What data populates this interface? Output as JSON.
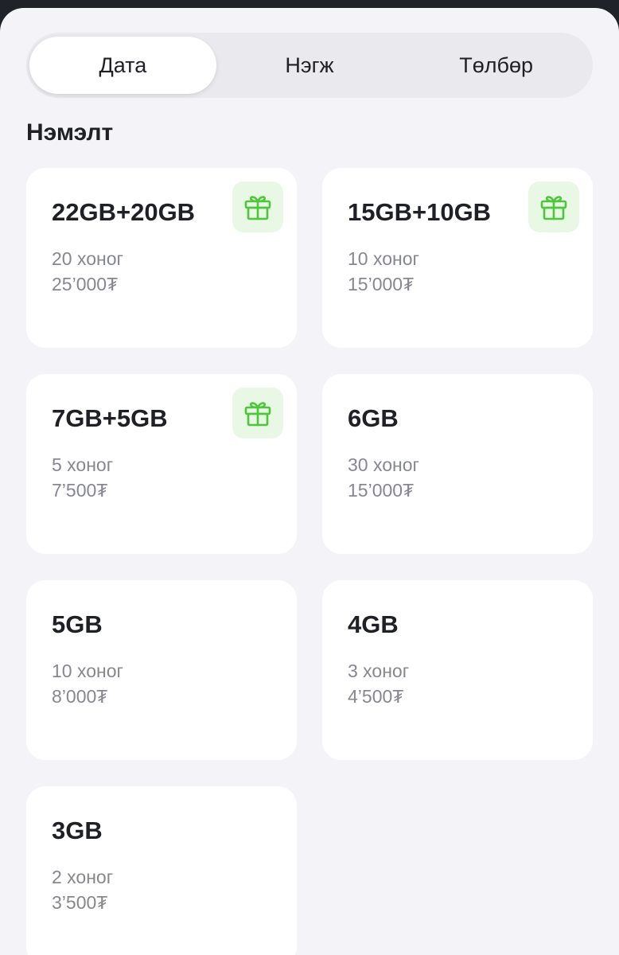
{
  "tabs": [
    {
      "label": "Дата",
      "active": true
    },
    {
      "label": "Нэгж",
      "active": false
    },
    {
      "label": "Төлбөр",
      "active": false
    }
  ],
  "section": {
    "title": "Нэмэлт"
  },
  "colors": {
    "accent_green": "#4cc73a",
    "gift_bg": "#e8f8e4"
  },
  "packages": [
    {
      "title": "22GB+20GB",
      "days": "20 хоног",
      "price": "25’000₮",
      "gift": true,
      "icon": "gift-icon"
    },
    {
      "title": "15GB+10GB",
      "days": "10 хоног",
      "price": "15’000₮",
      "gift": true,
      "icon": "gift-icon"
    },
    {
      "title": "7GB+5GB",
      "days": "5 хоног",
      "price": "7’500₮",
      "gift": true,
      "icon": "gift-icon"
    },
    {
      "title": "6GB",
      "days": "30 хоног",
      "price": "15’000₮",
      "gift": false
    },
    {
      "title": "5GB",
      "days": "10 хоног",
      "price": "8’000₮",
      "gift": false
    },
    {
      "title": "4GB",
      "days": "3 хоног",
      "price": "4’500₮",
      "gift": false
    },
    {
      "title": "3GB",
      "days": "2 хоног",
      "price": "3’500₮",
      "gift": false
    }
  ]
}
